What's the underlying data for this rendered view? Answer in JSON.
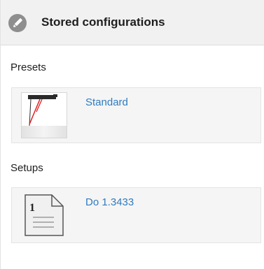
{
  "header": {
    "title": "Stored configurations",
    "icon": "pencil-icon"
  },
  "presets": {
    "label": "Presets",
    "items": [
      {
        "name": "Standard",
        "icon": "sensor-preset-icon"
      }
    ]
  },
  "setups": {
    "label": "Setups",
    "items": [
      {
        "name": "Do 1.3433",
        "icon": "document-icon",
        "badge": "1"
      }
    ]
  },
  "colors": {
    "link": "#2f7bbf",
    "header_bg": "#f1f1f1",
    "item_bg": "#f5f5f5",
    "laser": "#e02020"
  }
}
